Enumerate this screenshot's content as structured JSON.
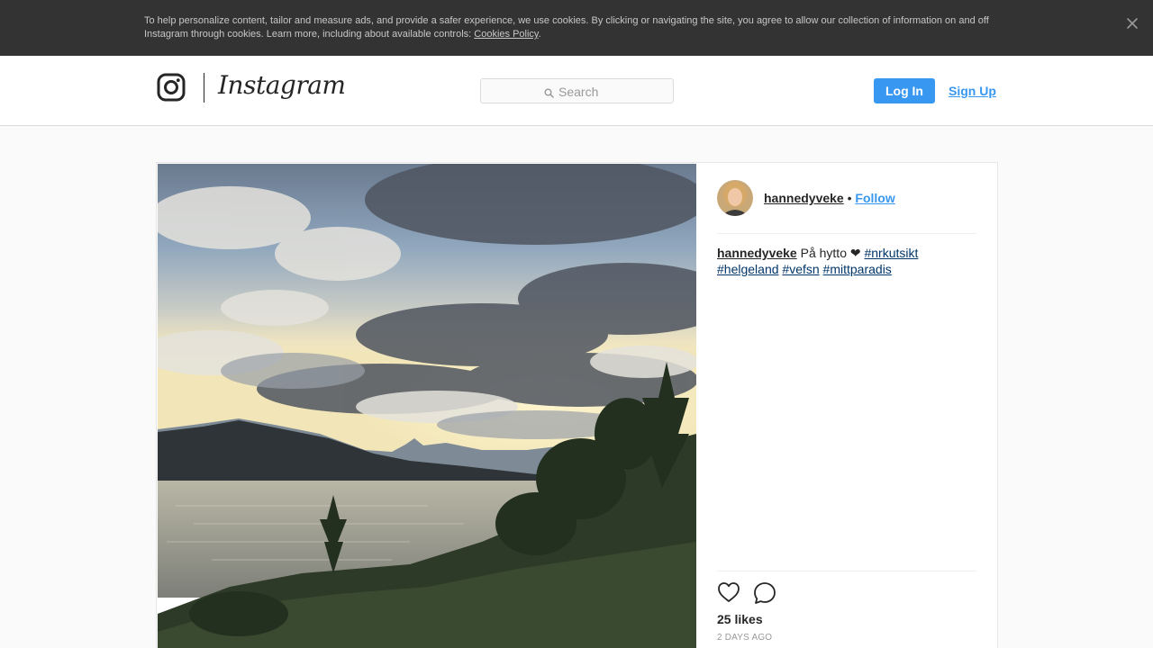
{
  "cookie_banner": {
    "text": "To help personalize content, tailor and measure ads, and provide a safer experience, we use cookies. By clicking or navigating the site, you agree to allow our collection of information on and off Instagram through cookies. Learn more, including about available controls: ",
    "link_label": "Cookies Policy",
    "trailing": ".",
    "close_icon": "close-icon"
  },
  "nav": {
    "brand": "Instagram",
    "search_placeholder": "Search",
    "login_label": "Log In",
    "signup_label": "Sign Up",
    "accent": "#3897f0"
  },
  "post": {
    "username": "hannedyveke",
    "separator": "•",
    "follow_label": "Follow",
    "caption": {
      "username": "hannedyveke",
      "text": " På hytto ❤ ",
      "tags": [
        "#nrkutsikt",
        "#helgeland",
        "#vefsn",
        "#mittparadis"
      ]
    },
    "likes": "25 likes",
    "time": "2 DAYS AGO"
  }
}
